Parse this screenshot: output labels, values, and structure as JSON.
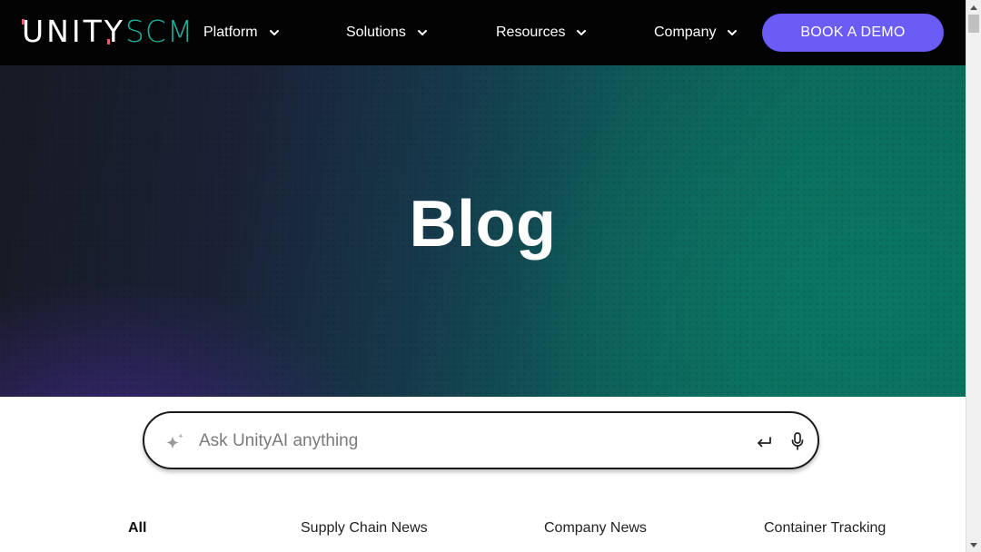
{
  "header": {
    "logo": {
      "part1": "UNITY",
      "part2": "SCM"
    },
    "nav": [
      {
        "label": "Platform"
      },
      {
        "label": "Solutions"
      },
      {
        "label": "Resources"
      },
      {
        "label": "Company"
      }
    ],
    "cta_label": "BOOK A DEMO"
  },
  "hero": {
    "title": "Blog"
  },
  "search": {
    "placeholder": "Ask UnityAI anything",
    "value": ""
  },
  "tabs": [
    {
      "label": "All",
      "active": true
    },
    {
      "label": "Supply Chain News",
      "active": false
    },
    {
      "label": "Company News",
      "active": false
    },
    {
      "label": "Container Tracking",
      "active": false
    }
  ],
  "colors": {
    "nav_bg": "#030303",
    "accent": "#6a5cf5",
    "logo_scm": "#1fb7a6",
    "logo_accent": "#e85a6a",
    "hero_teal": "#0c6a5c",
    "hero_purple": "#3c2882"
  },
  "icons": {
    "chevron": "chevron-down-icon",
    "sparkle": "sparkle-icon",
    "enter": "enter-icon",
    "mic": "microphone-icon"
  }
}
